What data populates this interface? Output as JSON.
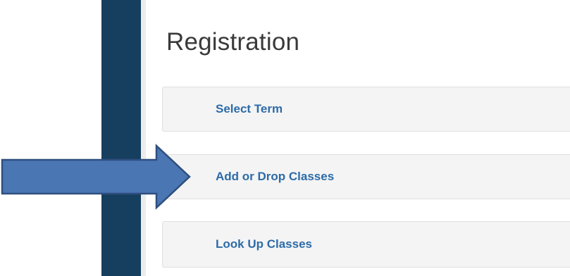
{
  "page": {
    "title": "Registration"
  },
  "menu": {
    "items": [
      {
        "label": "Select Term"
      },
      {
        "label": "Add or Drop Classes"
      },
      {
        "label": "Look Up Classes"
      }
    ]
  },
  "colors": {
    "sidebar": "#163f5f",
    "link": "#2c6ba8",
    "item_background": "#f4f4f4",
    "arrow_fill": "#4a76b3",
    "arrow_stroke": "#2f4f7f"
  },
  "annotation": {
    "icon": "arrow-right-icon"
  }
}
